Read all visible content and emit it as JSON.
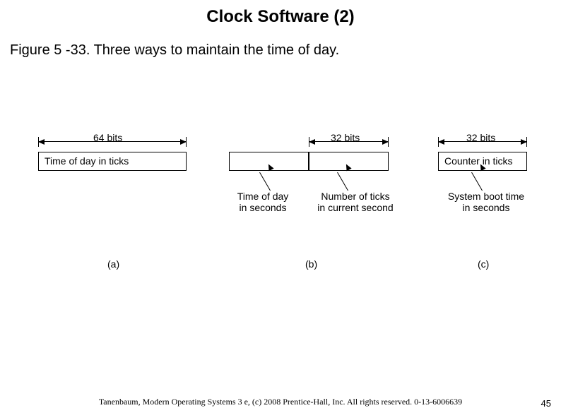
{
  "title": "Clock Software (2)",
  "caption": "Figure 5 -33. Three ways to maintain the time of day.",
  "fig": {
    "a": {
      "bits": "64 bits",
      "box_label": "Time of day in ticks",
      "part": "(a)"
    },
    "b": {
      "bits": "32 bits",
      "annot_left": "Time of day\nin seconds",
      "annot_right": "Number of ticks\nin current second",
      "part": "(b)"
    },
    "c": {
      "bits": "32 bits",
      "box_label": "Counter in ticks",
      "annot": "System boot time\nin seconds",
      "part": "(c)"
    }
  },
  "footer": "Tanenbaum, Modern Operating Systems 3 e, (c) 2008 Prentice-Hall, Inc. All rights reserved. 0-13-6006639",
  "page": "45"
}
